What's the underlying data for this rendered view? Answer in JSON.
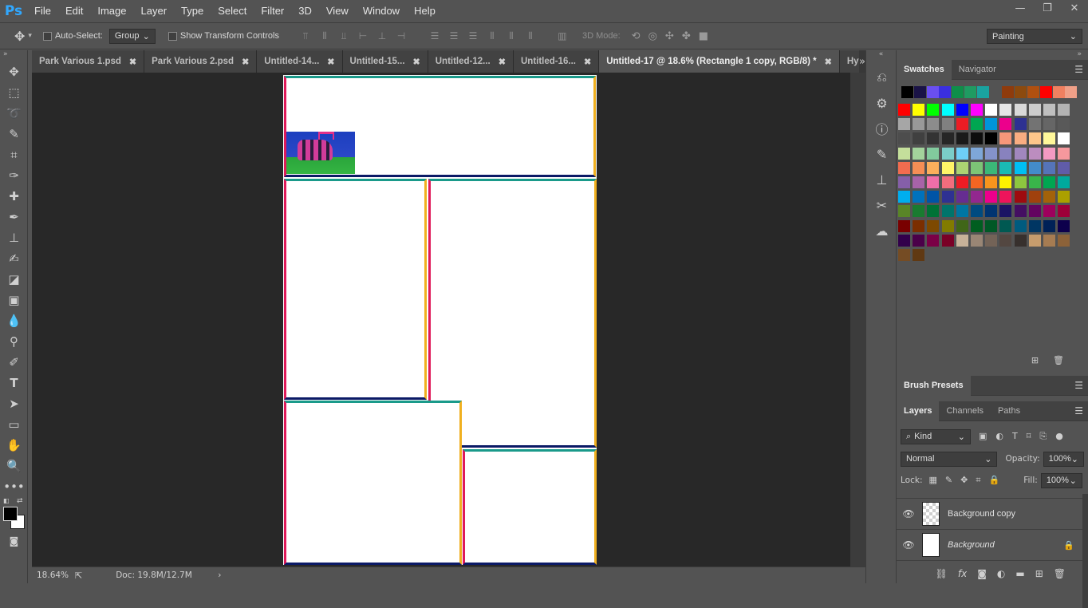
{
  "app": {
    "logo": "Ps"
  },
  "menu": [
    "File",
    "Edit",
    "Image",
    "Layer",
    "Type",
    "Select",
    "Filter",
    "3D",
    "View",
    "Window",
    "Help"
  ],
  "window_controls": {
    "minimize": "—",
    "restore": "❐",
    "close": "✕"
  },
  "options": {
    "auto_select_label": "Auto-Select:",
    "auto_select_value": "Group",
    "transform_label": "Show Transform Controls",
    "mode_label": "3D Mode:",
    "workspace_value": "Painting"
  },
  "tabs": [
    {
      "label": "Park Various 1.psd",
      "active": false
    },
    {
      "label": "Park Various 2.psd",
      "active": false
    },
    {
      "label": "Untitled-14...",
      "active": false
    },
    {
      "label": "Untitled-15...",
      "active": false
    },
    {
      "label": "Untitled-12...",
      "active": false
    },
    {
      "label": "Untitled-16...",
      "active": false
    },
    {
      "label": "Untitled-17 @ 18.6% (Rectangle 1 copy, RGB/8) *",
      "active": true
    },
    {
      "label": "Hyvax",
      "active": false
    }
  ],
  "tab_overflow": "»",
  "status": {
    "zoom": "18.64%",
    "doc": "Doc: 19.8M/12.7M",
    "arrow": "›"
  },
  "panels": {
    "swatches_tab": "Swatches",
    "navigator_tab": "Navigator",
    "brush_presets_tab": "Brush Presets",
    "layers_tab": "Layers",
    "channels_tab": "Channels",
    "paths_tab": "Paths",
    "kind_label": "Kind",
    "blend_mode": "Normal",
    "opacity_label": "Opacity:",
    "opacity_value": "100%",
    "lock_label": "Lock:",
    "fill_label": "Fill:",
    "fill_value": "100%"
  },
  "layers": [
    {
      "name": "Background copy",
      "visible": true,
      "transparent": true
    },
    {
      "name": "Background",
      "visible": true,
      "transparent": false,
      "locked": true
    }
  ],
  "swatch_rows": [
    [
      "#000000",
      "#1a1346",
      "#6a4ff0",
      "#3a2fe0",
      "#0e8f4a",
      "#1f9b62",
      "#1aa3a0",
      "#535353",
      "#8f3b0c",
      "#8c4a0e",
      "#b05010",
      "#ff0000",
      "#f08060",
      "#f0a088"
    ],
    [
      "#ff0000",
      "#ffff00",
      "#00ff00",
      "#00ffff",
      "#0000ff",
      "#ff00ff",
      "#ffffff",
      "#e6e6e6",
      "#d9d9d9",
      "#cccccc",
      "#bfbfbf",
      "#b3b3b3"
    ],
    [
      "#a6a6a6",
      "#999999",
      "#8c8c8c",
      "#808080",
      "#ed1c24",
      "#00a651",
      "#0095da",
      "#ec008c",
      "#2e3192",
      "#737373",
      "#666666",
      "#595959"
    ],
    [
      "#4d4d4d",
      "#404040",
      "#333333",
      "#262626",
      "#1a1a1a",
      "#0d0d0d",
      "#000000",
      "#f7977a",
      "#f9ad81",
      "#fdc68a",
      "#fff79a",
      "#ffffff"
    ],
    [
      "#c4df9b",
      "#a3d39c",
      "#82ca9d",
      "#7bcdc8",
      "#6ecff6",
      "#7ea7d8",
      "#8493ca",
      "#8882be",
      "#a187be",
      "#bc8dbf",
      "#f49ac2",
      "#f6989d"
    ],
    [
      "#f26c4f",
      "#f68e55",
      "#fbaf5c",
      "#fff467",
      "#acd372",
      "#7cc576",
      "#3bb878",
      "#1abbb4",
      "#00bff3",
      "#438cca",
      "#5574b9",
      "#605ca8"
    ],
    [
      "#855fa8",
      "#a763a8",
      "#f06ea9",
      "#f26d7d",
      "#ed1c24",
      "#f26522",
      "#f7941d",
      "#fff200",
      "#8dc63f",
      "#39b54a",
      "#00a651",
      "#00a99d"
    ],
    [
      "#00aeef",
      "#0072bc",
      "#0054a6",
      "#2e3192",
      "#662d91",
      "#92278f",
      "#ec008c",
      "#ed145b",
      "#9e0b0f",
      "#a0410d",
      "#a3620a",
      "#aba000"
    ],
    [
      "#598527",
      "#197b30",
      "#007236",
      "#00746b",
      "#0076a3",
      "#004b80",
      "#003471",
      "#1b1464",
      "#440e62",
      "#630460",
      "#9e005d",
      "#9e0039"
    ],
    [
      "#790000",
      "#7b2e00",
      "#7d4900",
      "#827b00",
      "#406618",
      "#005e20",
      "#005826",
      "#005952",
      "#005b7f",
      "#003663",
      "#002157",
      "#0d004c"
    ],
    [
      "#32004b",
      "#4b0049",
      "#7b0046",
      "#7a0026",
      "#c7b299",
      "#998675",
      "#736357",
      "#534741",
      "#37302d",
      "#c69c6d",
      "#a67c52",
      "#8c6239"
    ],
    [
      "#754c24",
      "#603913"
    ]
  ]
}
